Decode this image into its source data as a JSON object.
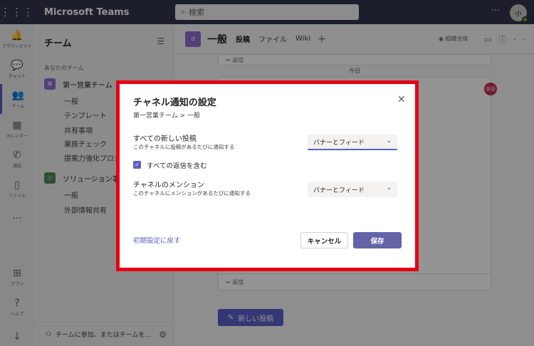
{
  "app": {
    "title": "Microsoft Teams",
    "search_placeholder": "検索",
    "more": "···",
    "avatar_initials": "小"
  },
  "rail": {
    "items": [
      {
        "label": "アクティビティ",
        "icon": "bell-icon",
        "glyph": "🔔"
      },
      {
        "label": "チャット",
        "icon": "chat-icon",
        "glyph": "💬"
      },
      {
        "label": "チーム",
        "icon": "teams-icon",
        "glyph": "👥"
      },
      {
        "label": "カレンダー",
        "icon": "calendar-icon",
        "glyph": "▦"
      },
      {
        "label": "通話",
        "icon": "phone-icon",
        "glyph": "✆"
      },
      {
        "label": "ファイル",
        "icon": "file-icon",
        "glyph": "▯"
      }
    ],
    "more": "···",
    "bottom": [
      {
        "label": "アプリ",
        "icon": "apps-icon",
        "glyph": "⊞"
      },
      {
        "label": "ヘルプ",
        "icon": "help-icon",
        "glyph": "?"
      }
    ],
    "download_glyph": "↓"
  },
  "panel": {
    "title": "チーム",
    "section": "あなたのチーム",
    "teams": [
      {
        "name": "第一営業チーム",
        "initial": "第",
        "color": "#8b6fd0",
        "channels": [
          "一般",
          "テンプレート",
          "共有事項",
          "業務チェック",
          "提案力強化プロジ"
        ]
      },
      {
        "name": "ソリューション事業部",
        "initial": "ソ",
        "color": "#4f8a5a",
        "channels": [
          "一般",
          "外部情報共有"
        ]
      }
    ],
    "footer": "チームに参加、またはチームを..."
  },
  "channel": {
    "badge": "d",
    "name": "一般",
    "tabs": [
      "投稿",
      "ファイル",
      "Wiki"
    ],
    "add": "+",
    "org": "組織全体",
    "date_separator": "今日",
    "reply": "返信",
    "new_post": "新しい投稿",
    "reaction": "@@"
  },
  "dialog": {
    "title": "チャネル通知の設定",
    "breadcrumb": "第一営業チーム > 一般",
    "close": "✕",
    "option1": {
      "label": "すべての新しい投稿",
      "desc": "このチャネルに投稿があるたびに通知する",
      "value": "バナーとフィード"
    },
    "checkbox": {
      "label": "すべての返信を含む",
      "checked": true
    },
    "option2": {
      "label": "チャネルのメンション",
      "desc": "このチャネルにメンションがあるたびに通知する",
      "value": "バナーとフィード"
    },
    "reset": "初期設定に戻す",
    "cancel": "キャンセル",
    "save": "保存"
  },
  "colors": {
    "accent": "#6264a7",
    "highlight": "#e60012",
    "topbar": "#33344a"
  }
}
